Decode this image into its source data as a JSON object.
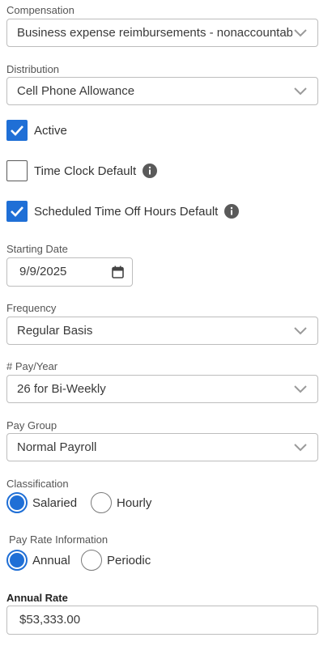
{
  "compensation": {
    "label": "Compensation",
    "value": "Business expense reimbursements - nonaccountable"
  },
  "distribution": {
    "label": "Distribution",
    "value": "Cell Phone Allowance"
  },
  "checkboxes": {
    "active": {
      "label": "Active",
      "checked": true
    },
    "time_clock_default": {
      "label": "Time Clock Default",
      "checked": false
    },
    "scheduled_time_off": {
      "label": "Scheduled Time Off Hours Default",
      "checked": true
    }
  },
  "starting_date": {
    "label": "Starting Date",
    "value": "9/9/2025"
  },
  "frequency": {
    "label": "Frequency",
    "value": "Regular Basis"
  },
  "pay_per_year": {
    "label": "# Pay/Year",
    "value": "26 for Bi-Weekly"
  },
  "pay_group": {
    "label": "Pay Group",
    "value": "Normal Payroll"
  },
  "classification": {
    "label": "Classification",
    "options": [
      {
        "label": "Salaried",
        "selected": true
      },
      {
        "label": "Hourly",
        "selected": false
      }
    ]
  },
  "pay_rate_information": {
    "label": "Pay Rate Information",
    "options": [
      {
        "label": "Annual",
        "selected": true
      },
      {
        "label": "Periodic",
        "selected": false
      }
    ]
  },
  "annual_rate": {
    "label": "Annual Rate",
    "value": "$53,333.00"
  },
  "colors": {
    "accent": "#1f6fd6",
    "border": "#bdbdbd",
    "text": "#333333",
    "label": "#555555"
  },
  "icons": {
    "select": "chevron-down-icon",
    "checkbox": "checkmark-icon",
    "info": "info-icon",
    "date": "calendar-icon"
  }
}
